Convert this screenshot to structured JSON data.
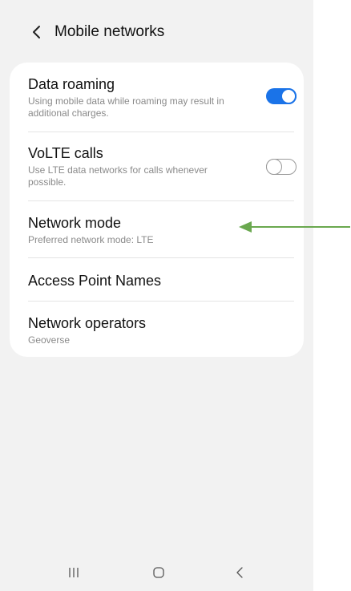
{
  "header": {
    "title": "Mobile networks",
    "back_icon": "chevron-left-icon"
  },
  "settings": [
    {
      "title": "Data roaming",
      "subtitle": "Using mobile data while roaming may result in additional charges.",
      "toggle": "on"
    },
    {
      "title": "VoLTE calls",
      "subtitle": "Use LTE data networks for calls whenever possible.",
      "toggle": "off"
    },
    {
      "title": "Network mode",
      "subtitle": "Preferred network mode: LTE"
    },
    {
      "title": "Access Point Names"
    },
    {
      "title": "Network operators",
      "subtitle": "Geoverse"
    }
  ],
  "navbar": {
    "recents_icon": "recents-icon",
    "home_icon": "home-icon",
    "back_icon": "back-icon"
  },
  "annotation": {
    "arrow_color": "#6aa84f",
    "icon": "arrow-left-icon"
  },
  "colors": {
    "accent": "#1a73e8",
    "background": "#f2f2f2",
    "card": "#ffffff"
  }
}
